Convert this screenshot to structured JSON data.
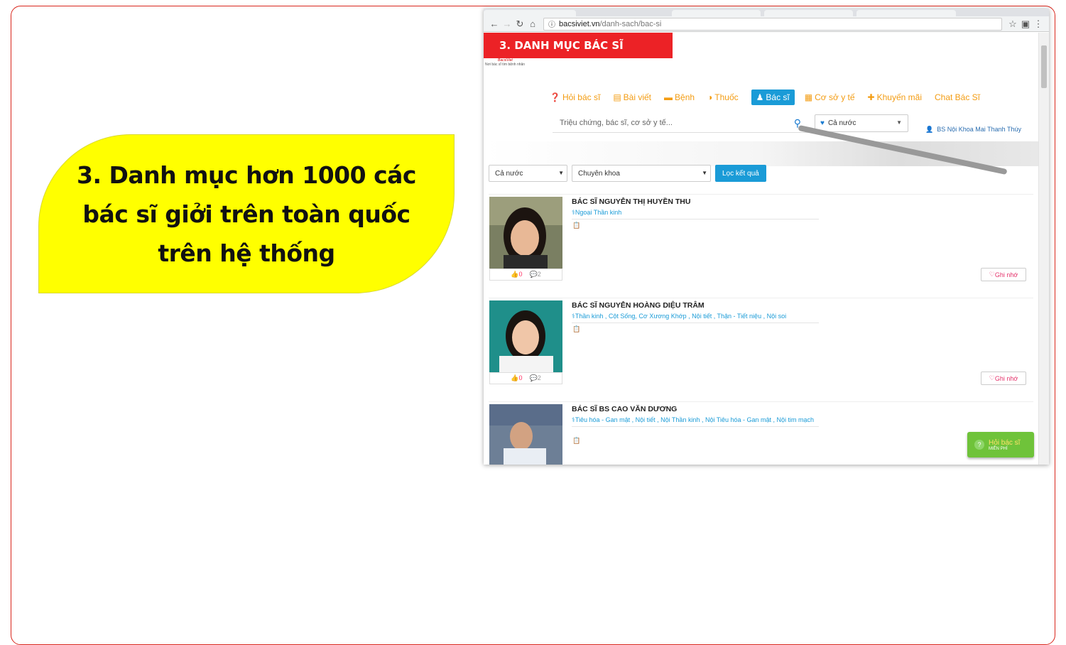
{
  "callout": {
    "text": "3. Danh mục hơn 1000 các bác sĩ giởi trên toàn quốc trên hệ thống"
  },
  "browser": {
    "url_host": "bacsiviet.vn",
    "url_path": "/danh-sach/bac-si"
  },
  "banner": {
    "text": "3. DANH MỤC BÁC SĨ"
  },
  "logo": {
    "brand": "BacsiViet",
    "tagline": "Nơi bác sĩ tìm bệnh nhân"
  },
  "menu": [
    {
      "icon": "question-icon",
      "glyph": "❓",
      "label": "Hỏi bác sĩ",
      "active": false
    },
    {
      "icon": "newspaper-icon",
      "glyph": "▤",
      "label": "Bài viết",
      "active": false
    },
    {
      "icon": "bed-icon",
      "glyph": "▬",
      "label": "Bệnh",
      "active": false
    },
    {
      "icon": "pill-icon",
      "glyph": "◑",
      "label": "Thuốc",
      "active": false
    },
    {
      "icon": "doctor-icon",
      "glyph": "♟",
      "label": "Bác sĩ",
      "active": true
    },
    {
      "icon": "hospital-icon",
      "glyph": "▦",
      "label": "Cơ sở y tế",
      "active": false
    },
    {
      "icon": "gift-icon",
      "glyph": "✚",
      "label": "Khuyến mãi",
      "active": false
    },
    {
      "icon": "",
      "glyph": "",
      "label": "Chat Bác Sĩ",
      "active": false
    }
  ],
  "search": {
    "placeholder": "Triệu chứng, bác sĩ, cơ sở y tế..."
  },
  "region": {
    "value": "Cả nước"
  },
  "user": {
    "name": "BS Nội Khoa Mai Thanh Thúy"
  },
  "filters": {
    "region": "Cả nước",
    "specialty": "Chuyên khoa",
    "button": "Lọc kết quả"
  },
  "doctors": [
    {
      "name": "BÁC SĨ NGUYỄN THỊ HUYỀN THU",
      "specialty": "Ngoại Thần kinh",
      "likes": "0",
      "comments": "2",
      "save": "Ghi nhớ"
    },
    {
      "name": "BÁC SĨ NGUYỄN HOÀNG DIỆU TRÂM",
      "specialty": "Thần kinh , Cột Sống, Cơ Xương Khớp , Nội tiết , Thận - Tiết niệu , Nội soi",
      "likes": "0",
      "comments": "2",
      "save": "Ghi nhớ"
    },
    {
      "name": "BÁC SĨ BS CAO VĂN DƯƠNG",
      "specialty": "Tiêu hóa - Gan mật , Nội tiết , Nội Thần kinh , Nội Tiêu hóa - Gan mật , Nội tim mạch",
      "likes": "",
      "comments": "",
      "save": ""
    }
  ],
  "float_button": {
    "label": "Hỏi bác sĩ",
    "sub": "MIỄN PHÍ"
  }
}
